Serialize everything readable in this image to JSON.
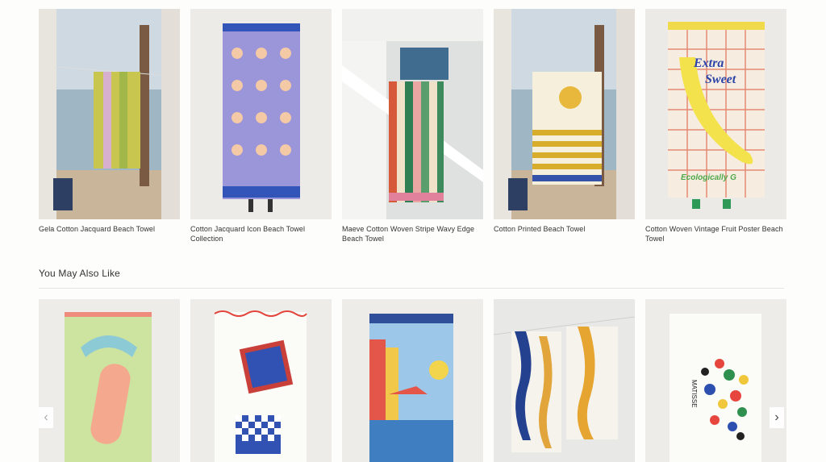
{
  "products": [
    {
      "name": "Gela Cotton Jacquard Beach Towel"
    },
    {
      "name": "Cotton Jacquard Icon Beach Towel Collection"
    },
    {
      "name": "Maeve Cotton Woven Stripe Wavy Edge Beach Towel"
    },
    {
      "name": "Cotton Printed Beach Towel"
    },
    {
      "name": "Cotton Woven Vintage Fruit Poster Beach Towel"
    }
  ],
  "recommendations": {
    "title": "You May Also Like",
    "prev_icon": "‹",
    "next_icon": "›"
  },
  "artwork_text": {
    "fruit_poster": [
      "Extra",
      "Sweet",
      "Ecologically G"
    ],
    "matisse": "MATISSE"
  }
}
